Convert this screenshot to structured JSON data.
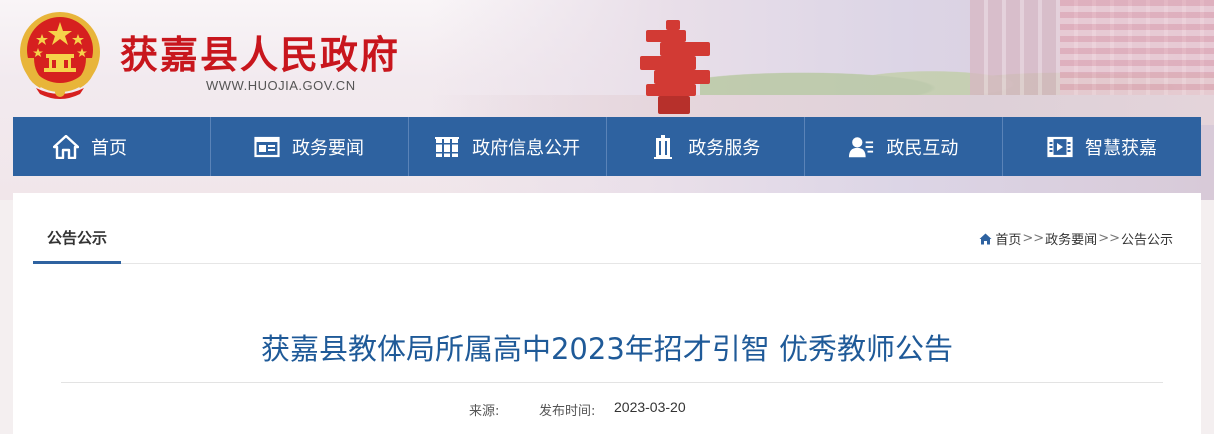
{
  "header": {
    "site_title": "获嘉县人民政府",
    "site_url": "WWW.HUOJIA.GOV.CN",
    "emblem_icon": "national-emblem-icon",
    "brand_color": "#c8161d"
  },
  "nav": {
    "bg_color": "#2e62a0",
    "items": [
      {
        "label": "首页",
        "icon": "home-icon"
      },
      {
        "label": "政务要闻",
        "icon": "news-icon"
      },
      {
        "label": "政府信息公开",
        "icon": "books-icon"
      },
      {
        "label": "政务服务",
        "icon": "building-icon"
      },
      {
        "label": "政民互动",
        "icon": "user-chat-icon"
      },
      {
        "label": "智慧获嘉",
        "icon": "film-icon"
      }
    ]
  },
  "section": {
    "tab_title": "公告公示",
    "breadcrumb": {
      "home": "首页",
      "sep1": ">>",
      "level2": "政务要闻",
      "sep2": ">>",
      "level3": "公告公示"
    }
  },
  "article": {
    "title": "获嘉县教体局所属高中2023年招才引智 优秀教师公告",
    "source_label": "来源:",
    "time_label": "发布时间:",
    "time_value": "2023-03-20"
  }
}
